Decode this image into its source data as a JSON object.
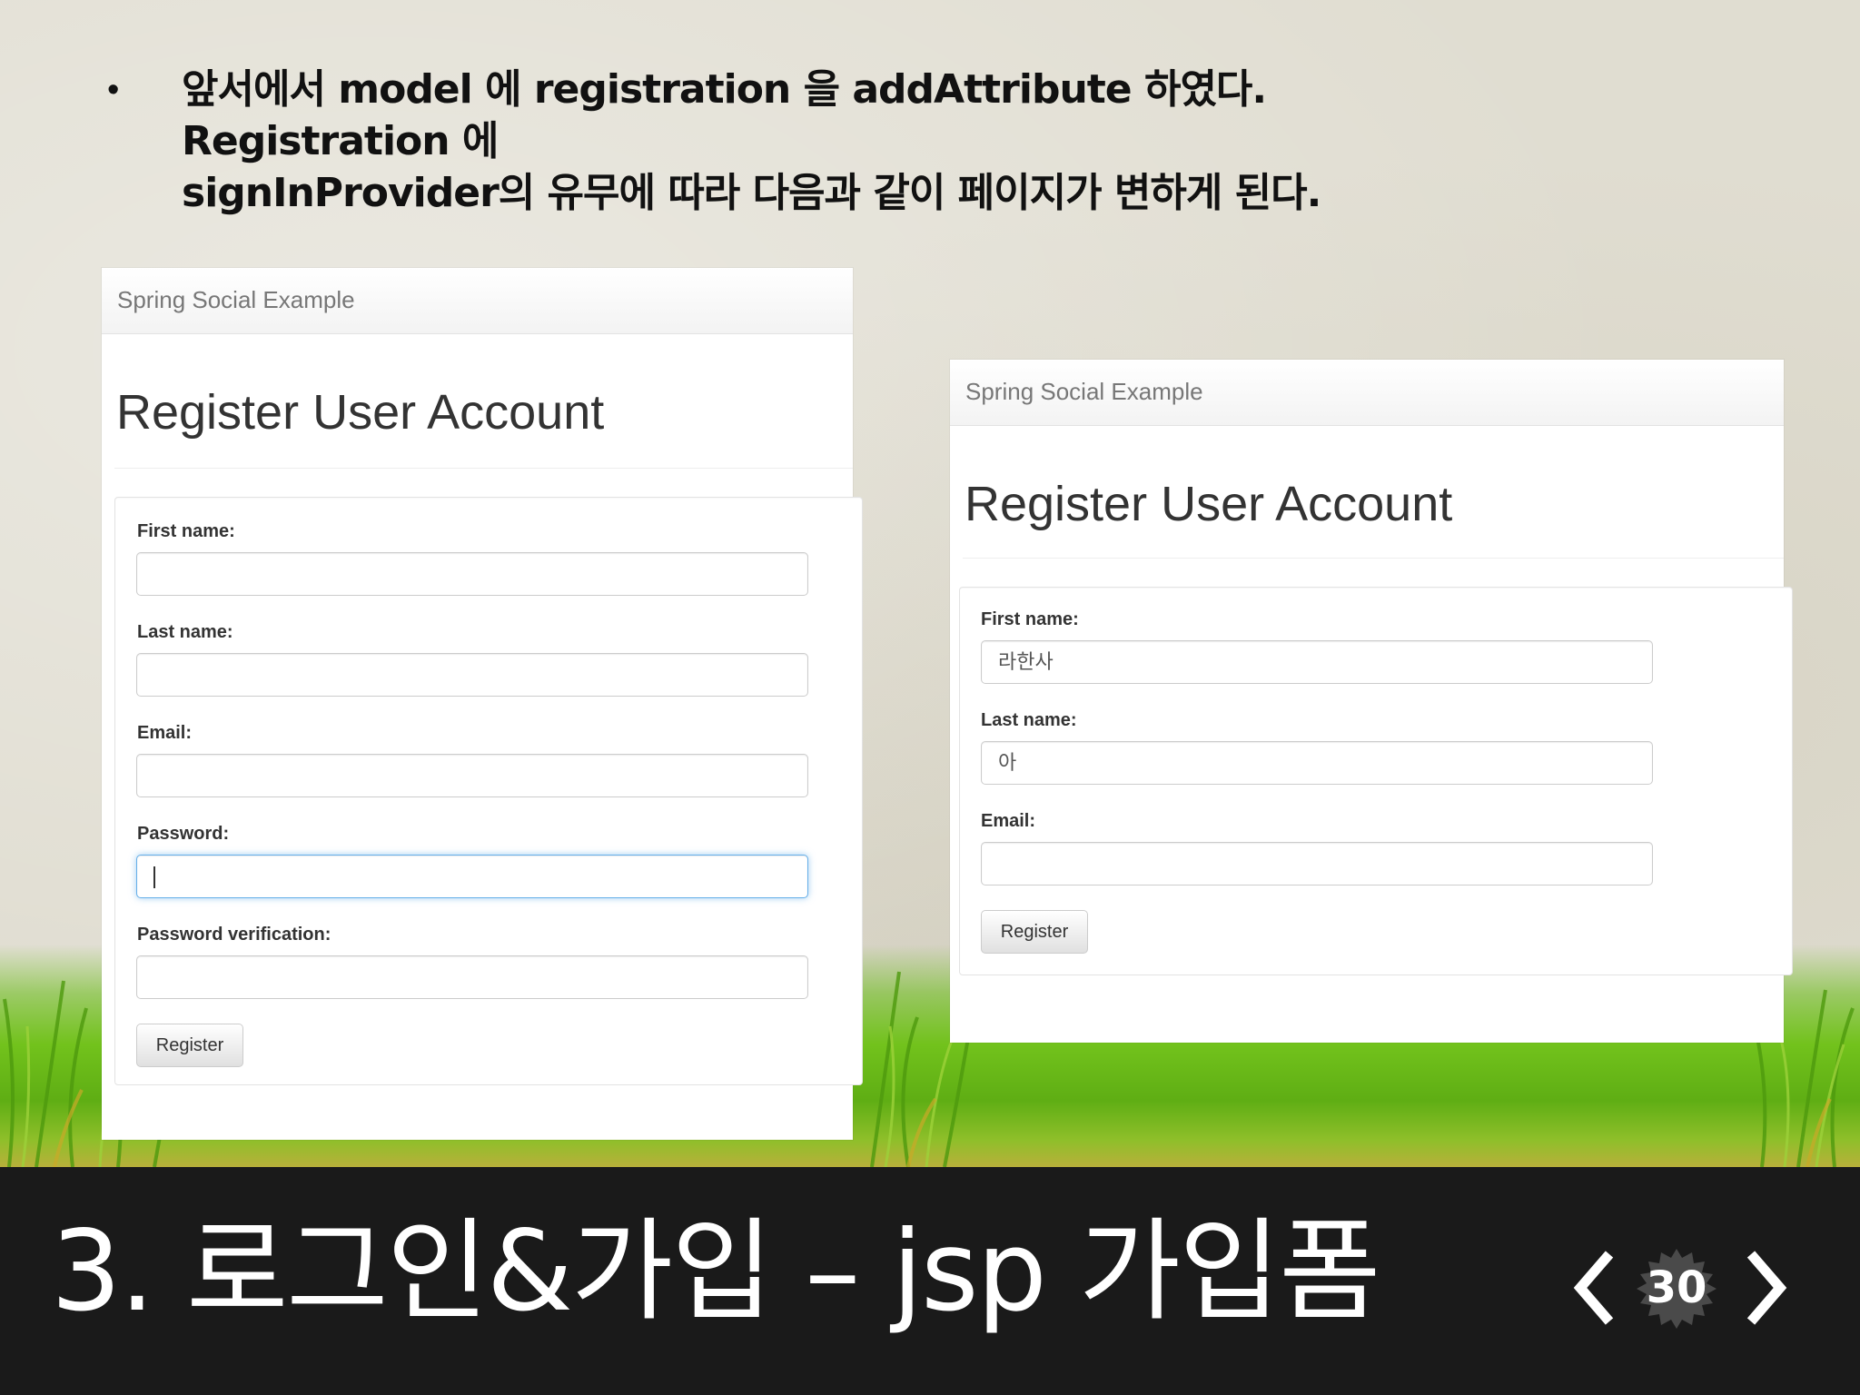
{
  "bullet": {
    "line1": "앞서에서 model 에 registration 을 addAttribute 하였다. Registration 에",
    "line2": "signInProvider의 유무에 따라 다음과 같이 페이지가 변하게 된다."
  },
  "left_screen": {
    "brand": "Spring Social Example",
    "title": "Register User Account",
    "fields": [
      {
        "label": "First name:",
        "value": ""
      },
      {
        "label": "Last name:",
        "value": ""
      },
      {
        "label": "Email:",
        "value": ""
      },
      {
        "label": "Password:",
        "value": ""
      },
      {
        "label": "Password verification:",
        "value": ""
      }
    ],
    "register_button": "Register"
  },
  "right_screen": {
    "brand": "Spring Social Example",
    "title": "Register User Account",
    "fields": [
      {
        "label": "First name:",
        "value": "라한사"
      },
      {
        "label": "Last name:",
        "value": "아"
      },
      {
        "label": "Email:",
        "value": ""
      }
    ],
    "register_button": "Register"
  },
  "footer": {
    "title": "3. 로그인&가입 – jsp 가입폼",
    "page_number": "30"
  },
  "colors": {
    "footer_bg": "#1a1a1a",
    "focus_border": "#66afe9",
    "grass": "#72c21c"
  },
  "icons": {
    "prev": "chevron-left-icon",
    "next": "chevron-right-icon",
    "badge": "starburst-badge-icon"
  }
}
